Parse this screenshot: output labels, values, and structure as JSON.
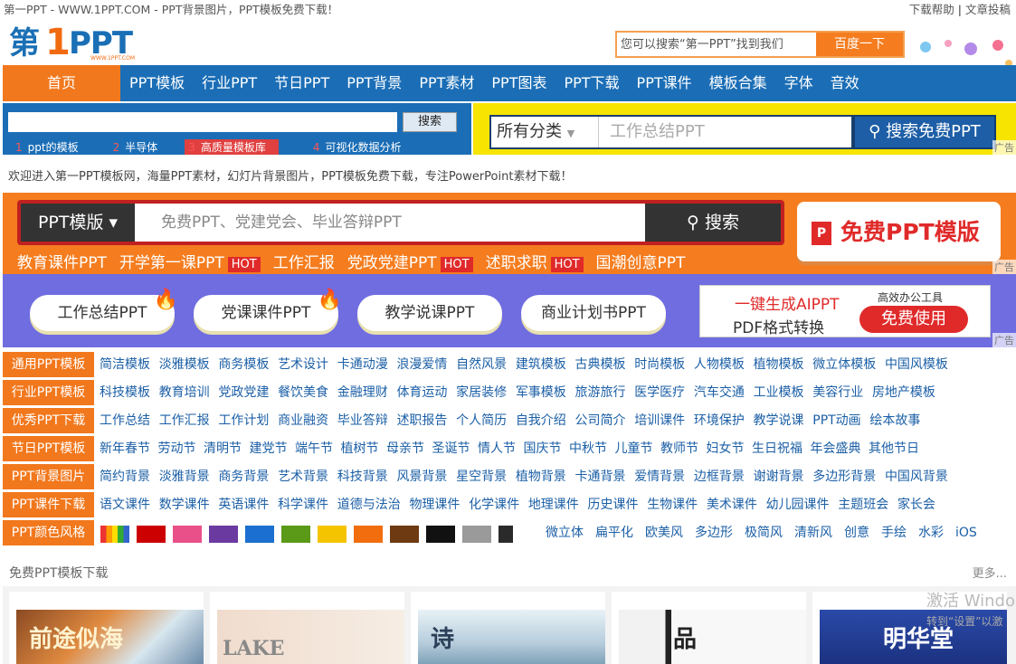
{
  "topbar": {
    "title": "第一PPT - WWW.1PPT.COM - PPT背景图片，PPT模板免费下载！",
    "help": "下载帮助",
    "sep": "|",
    "submit": "文章投稿"
  },
  "logo": {
    "p1": "第",
    "p2": "1",
    "p3": "PPT",
    "domain": "WWW.1PPT.COM"
  },
  "header_search": {
    "placeholder": "您可以搜索“第一PPT”找到我们",
    "button": "百度一下"
  },
  "nav": {
    "home": "首页",
    "items": [
      "PPT模板",
      "行业PPT",
      "节日PPT",
      "PPT背景",
      "PPT素材",
      "PPT图表",
      "PPT下载",
      "PPT课件",
      "模板合集",
      "字体",
      "音效"
    ]
  },
  "ad1": {
    "button": "搜索",
    "tags": [
      {
        "n": "1",
        "t": "ppt的模板"
      },
      {
        "n": "2",
        "t": "半导体"
      },
      {
        "n": "3",
        "t": "高质量模板库"
      },
      {
        "n": "4",
        "t": "可视化数据分析"
      }
    ]
  },
  "ad2": {
    "select": "所有分类",
    "placeholder": "工作总结PPT",
    "button": "搜索免费PPT",
    "ad": "广告"
  },
  "welcome": "欢迎进入第一PPT模板网，海量PPT素材，幻灯片背景图片，PPT模板免费下载，专注PowerPoint素材下载！",
  "banner": {
    "category": "PPT模版",
    "placeholder": "免费PPT、党建党会、毕业答辩PPT",
    "search": "搜索",
    "free": "免费PPT模版",
    "free_icon": "P",
    "tags": [
      {
        "t": "教育课件PPT",
        "hot": ""
      },
      {
        "t": "开学第一课PPT",
        "hot": "HOT"
      },
      {
        "t": "工作汇报",
        "hot": ""
      },
      {
        "t": "党政党建PPT",
        "hot": "HOT"
      },
      {
        "t": "述职求职",
        "hot": "HOT"
      },
      {
        "t": "国潮创意PPT",
        "hot": ""
      }
    ],
    "ad": "广告"
  },
  "pills": {
    "items": [
      "工作总结PPT",
      "党课课件PPT",
      "教学说课PPT",
      "商业计划书PPT"
    ],
    "ai_line1": "一键生成AIPPT",
    "ai_line2": "PDF格式转换",
    "ai_tag": "高效办公工具",
    "ai_btn": "免费使用",
    "ad": "广告"
  },
  "categories": [
    {
      "label": "通用PPT模板",
      "items": [
        "简洁模板",
        "淡雅模板",
        "商务模板",
        "艺术设计",
        "卡通动漫",
        "浪漫爱情",
        "自然风景",
        "建筑模板",
        "古典模板",
        "时尚模板",
        "人物模板",
        "植物模板",
        "微立体模板",
        "中国风模板"
      ]
    },
    {
      "label": "行业PPT模板",
      "items": [
        "科技模板",
        "教育培训",
        "党政党建",
        "餐饮美食",
        "金融理财",
        "体育运动",
        "家居装修",
        "军事模板",
        "旅游旅行",
        "医学医疗",
        "汽车交通",
        "工业模板",
        "美容行业",
        "房地产模板"
      ]
    },
    {
      "label": "优秀PPT下载",
      "items": [
        "工作总结",
        "工作汇报",
        "工作计划",
        "商业融资",
        "毕业答辩",
        "述职报告",
        "个人简历",
        "自我介绍",
        "公司简介",
        "培训课件",
        "环境保护",
        "教学说课",
        "PPT动画",
        "绘本故事"
      ]
    },
    {
      "label": "节日PPT模板",
      "items": [
        "新年春节",
        "劳动节",
        "清明节",
        "建党节",
        "端午节",
        "植树节",
        "母亲节",
        "圣诞节",
        "情人节",
        "国庆节",
        "中秋节",
        "儿童节",
        "教师节",
        "妇女节",
        "生日祝福",
        "年会盛典",
        "其他节日"
      ]
    },
    {
      "label": "PPT背景图片",
      "items": [
        "简约背景",
        "淡雅背景",
        "商务背景",
        "艺术背景",
        "科技背景",
        "风景背景",
        "星空背景",
        "植物背景",
        "卡通背景",
        "爱情背景",
        "边框背景",
        "谢谢背景",
        "多边形背景",
        "中国风背景"
      ]
    },
    {
      "label": "PPT课件下载",
      "items": [
        "语文课件",
        "数学课件",
        "英语课件",
        "科学课件",
        "道德与法治",
        "物理课件",
        "化学课件",
        "地理课件",
        "历史课件",
        "生物课件",
        "美术课件",
        "幼儿园课件",
        "主题班会",
        "家长会"
      ]
    }
  ],
  "colors": {
    "label": "PPT颜色风格",
    "swatches": [
      "#cc0000",
      "#e9508a",
      "#6b3aa0",
      "#1a6fd0",
      "#5a9a18",
      "#f5c400",
      "#f26d0e",
      "#6e3a12",
      "#111111",
      "#9a9a9a",
      "#2a2a2a"
    ],
    "styles": [
      "微立体",
      "扁平化",
      "欧美风",
      "多边形",
      "极简风",
      "清新风",
      "创意",
      "手绘",
      "水彩",
      "iOS"
    ]
  },
  "section": {
    "title": "免费PPT模板下载",
    "more": "更多..."
  },
  "thumbs": [
    {
      "text": "前途似海"
    },
    {
      "text": "LAKE"
    },
    {
      "text": "诗"
    },
    {
      "text": "品"
    },
    {
      "text": "明华堂"
    }
  ],
  "watermark": {
    "l1": "激活 Windo",
    "l2": "转到“设置”以激"
  }
}
